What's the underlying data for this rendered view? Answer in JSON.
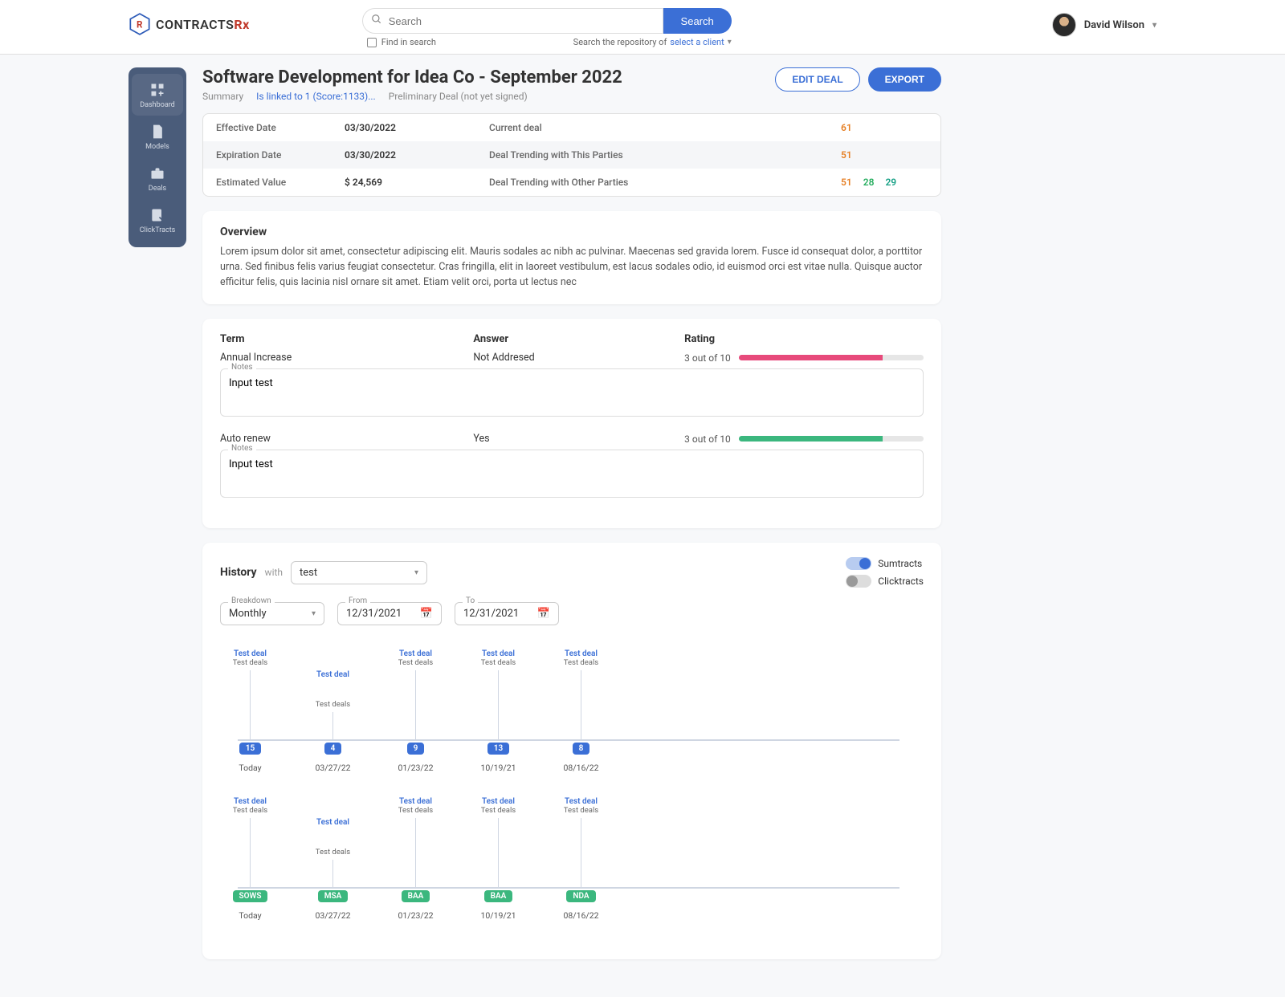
{
  "app": {
    "brand": "CONTRACTS",
    "brand_suffix": "Rx"
  },
  "search": {
    "placeholder": "Search",
    "button": "Search",
    "find_label": "Find in search",
    "repo_label": "Search the repository of",
    "client_link": "select a client"
  },
  "user": {
    "name": "David Wilson"
  },
  "sidebar": {
    "items": [
      {
        "label": "Dashboard"
      },
      {
        "label": "Models"
      },
      {
        "label": "Deals"
      },
      {
        "label": "ClickTracts"
      }
    ]
  },
  "page": {
    "title": "Software Development for Idea Co - September 2022",
    "tabs": {
      "summary": "Summary",
      "linked": "Is linked to 1 (Score:1133)...",
      "status": "Preliminary Deal (not yet signed)"
    },
    "buttons": {
      "edit": "EDIT DEAL",
      "export": "EXPORT"
    }
  },
  "info": {
    "rows": [
      {
        "label": "Effective Date",
        "value": "03/30/2022",
        "label2": "Current deal",
        "nums": [
          {
            "v": "61",
            "c": "orange"
          }
        ]
      },
      {
        "label": "Expiration Date",
        "value": "03/30/2022",
        "label2": "Deal Trending with This Parties",
        "nums": [
          {
            "v": "51",
            "c": "orange"
          }
        ]
      },
      {
        "label": "Estimated Value",
        "value": "$ 24,569",
        "label2": "Deal Trending with Other Parties",
        "nums": [
          {
            "v": "51",
            "c": "orange"
          },
          {
            "v": "28",
            "c": "green"
          },
          {
            "v": "29",
            "c": "teal"
          }
        ]
      }
    ]
  },
  "overview": {
    "heading": "Overview",
    "text": "Lorem ipsum dolor sit amet, consectetur adipiscing elit. Mauris sodales ac nibh ac pulvinar. Maecenas sed gravida lorem. Fusce id consequat dolor, a porttitor urna. Sed finibus felis varius feugiat consectetur. Cras fringilla, elit in laoreet vestibulum, est lacus sodales odio, id euismod orci est vitae nulla. Quisque auctor efficitur felis, quis lacinia nisl ornare sit amet. Etiam velit orci, porta ut lectus nec"
  },
  "terms": {
    "head": {
      "term": "Term",
      "answer": "Answer",
      "rating": "Rating"
    },
    "notes_label": "Notes",
    "rows": [
      {
        "term": "Annual Increase",
        "answer": "Not Addresed",
        "rating_text": "3 out of 10",
        "pct": 78,
        "color": "#e74a7b",
        "notes": "Input test"
      },
      {
        "term": "Auto renew",
        "answer": "Yes",
        "rating_text": "3 out of 10",
        "pct": 78,
        "color": "#3bb77e",
        "notes": "Input test"
      }
    ]
  },
  "history": {
    "heading": "History",
    "with": "with",
    "select_value": "test",
    "toggles": {
      "sumtracts": "Sumtracts",
      "clicktracts": "Clicktracts"
    },
    "filters": {
      "breakdown_label": "Breakdown",
      "breakdown": "Monthly",
      "from_label": "From",
      "from": "12/31/2021",
      "to_label": "To",
      "to": "12/31/2021"
    },
    "timeline1": [
      {
        "title": "Test deal",
        "sub": "Test deals",
        "badge": "15",
        "date": "Today",
        "offset": false
      },
      {
        "title": "Test deal",
        "sub": "Test deals",
        "badge": "4",
        "date": "03/27/22",
        "offset": true
      },
      {
        "title": "Test deal",
        "sub": "Test deals",
        "badge": "9",
        "date": "01/23/22",
        "offset": false
      },
      {
        "title": "Test deal",
        "sub": "Test deals",
        "badge": "13",
        "date": "10/19/21",
        "offset": false
      },
      {
        "title": "Test deal",
        "sub": "Test deals",
        "badge": "8",
        "date": "08/16/22",
        "offset": false
      }
    ],
    "timeline2": [
      {
        "title": "Test deal",
        "sub": "Test deals",
        "badge": "SOWS",
        "date": "Today",
        "offset": false
      },
      {
        "title": "Test deal",
        "sub": "Test deals",
        "badge": "MSA",
        "date": "03/27/22",
        "offset": true
      },
      {
        "title": "Test deal",
        "sub": "Test deals",
        "badge": "BAA",
        "date": "01/23/22",
        "offset": false
      },
      {
        "title": "Test deal",
        "sub": "Test deals",
        "badge": "BAA",
        "date": "10/19/21",
        "offset": false
      },
      {
        "title": "Test deal",
        "sub": "Test deals",
        "badge": "NDA",
        "date": "08/16/22",
        "offset": false
      }
    ]
  }
}
